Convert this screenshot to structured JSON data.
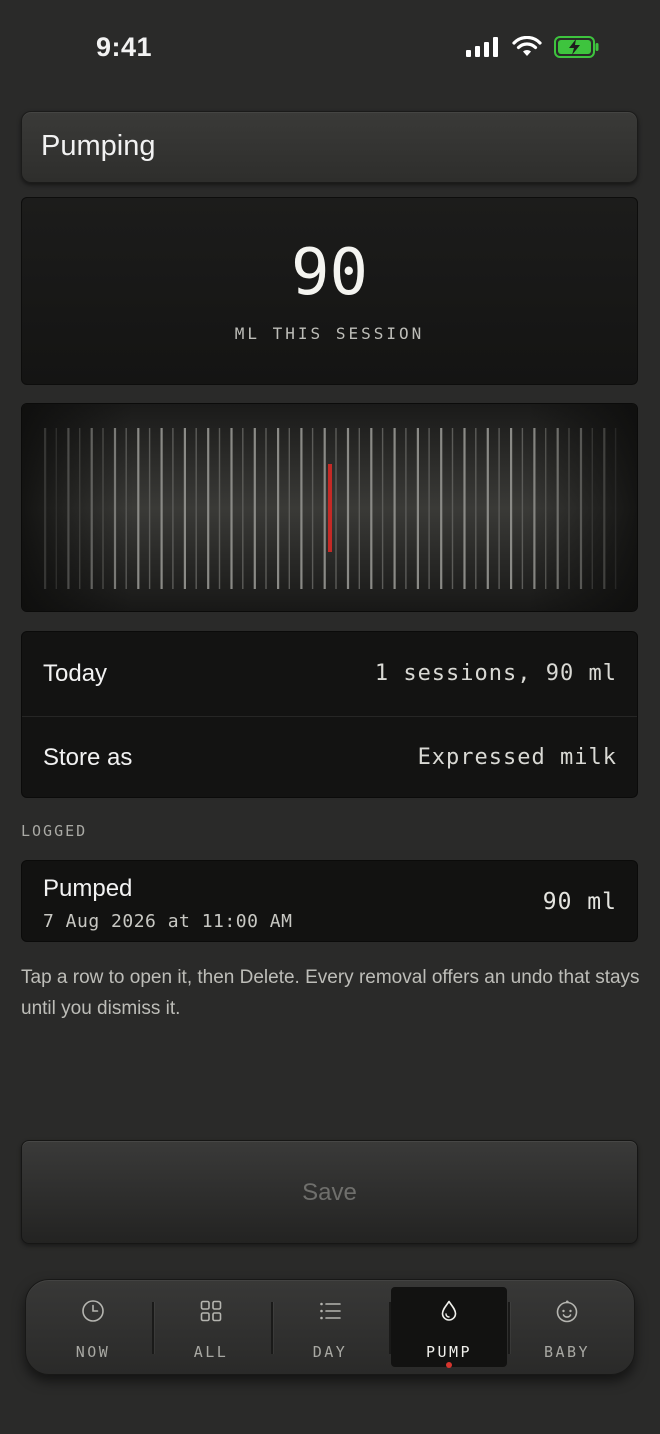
{
  "status_bar": {
    "time": "9:41",
    "signal_icon": "cellular-signal-icon",
    "wifi_icon": "wifi-icon",
    "battery_icon": "battery-charging-icon",
    "battery_color": "#3ec43e"
  },
  "header": {
    "title": "Pumping"
  },
  "readout": {
    "value": "90",
    "unit": "ML THIS SESSION"
  },
  "dial": {
    "indicator_color": "#c42a26",
    "indicator_value_ml": 90
  },
  "settings": {
    "today": {
      "label": "Today",
      "value": "1 sessions, 90 ml"
    },
    "store_as": {
      "label": "Store as",
      "value": "Expressed milk"
    }
  },
  "logged": {
    "section_label": "LOGGED",
    "items": [
      {
        "title": "Pumped",
        "date": "7 Aug 2026 at 11:00 AM",
        "value": "90 ml"
      }
    ]
  },
  "help_text": "Tap a row to open it, then Delete. Every removal offers an undo that stays until you dismiss it.",
  "save": {
    "label": "Save"
  },
  "tabs": [
    {
      "label": "NOW",
      "icon": "clock-icon",
      "active": false
    },
    {
      "label": "ALL",
      "icon": "grid-icon",
      "active": false
    },
    {
      "label": "DAY",
      "icon": "list-icon",
      "active": false
    },
    {
      "label": "PUMP",
      "icon": "droplet-icon",
      "active": true
    },
    {
      "label": "BABY",
      "icon": "baby-face-icon",
      "active": false
    }
  ],
  "colors": {
    "accent_red": "#d6352e",
    "background": "#2a2a29"
  }
}
